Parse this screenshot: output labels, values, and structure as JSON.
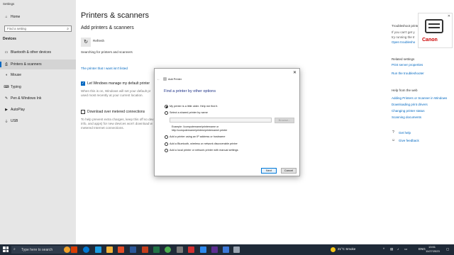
{
  "window": {
    "title": "Settings"
  },
  "sidebar": {
    "home": "Home",
    "search_placeholder": "Find a setting",
    "section": "Devices",
    "items": [
      {
        "label": "Bluetooth & other devices"
      },
      {
        "label": "Printers & scanners"
      },
      {
        "label": "Mouse"
      },
      {
        "label": "Typing"
      },
      {
        "label": "Pen & Windows Ink"
      },
      {
        "label": "AutoPlay"
      },
      {
        "label": "USB"
      }
    ]
  },
  "main": {
    "title": "Printers & scanners",
    "add_heading": "Add printers & scanners",
    "refresh": "Refresh",
    "searching": "Searching for printers and scanners",
    "not_listed": "The printer that I want isn't listed",
    "manage_default": "Let Windows manage my default printer",
    "manage_desc_1": "When this is on, Windows will set your default pr",
    "manage_desc_2": "used most recently at your current location.",
    "metered_label": "Download over metered connections",
    "metered_desc_1": "To help prevent extra charges, keep this off so dev",
    "metered_desc_2": "info, and apps) for new devices won't download w",
    "metered_desc_3": "metered Internet connections."
  },
  "dialog": {
    "title": "Add Printer",
    "heading": "Find a printer by other options",
    "options": [
      {
        "label": "My printer is a little older. Help me find it.",
        "selected": true
      },
      {
        "label": "Select a shared printer by name",
        "selected": false
      },
      {
        "label": "Add a printer using an IP address or hostname",
        "selected": false
      },
      {
        "label": "Add a Bluetooth, wireless or network discoverable printer",
        "selected": false
      },
      {
        "label": "Add a local printer or network printer with manual settings",
        "selected": false
      }
    ],
    "browse": "Browse...",
    "example_1": "Example: \\\\computername\\printername or",
    "example_2": "http://computername/printers/printername/.printer",
    "next": "Next",
    "cancel": "Cancel"
  },
  "right_panel": {
    "troubleshoot_title": "Troubleshoot printers",
    "troubleshoot_desc_1": "If you can't get y",
    "troubleshoot_desc_2": "try running the tr",
    "open_troubleshooter": "Open troublesho",
    "related_title": "Related settings",
    "related_links": [
      "Print server properties",
      "Run the troubleshooter"
    ],
    "help_title": "Help from the web",
    "help_links": [
      "Adding Printers or Scanner in Windows",
      "Downloading print drivers",
      "Changing printer status",
      "Scanning documents"
    ],
    "get_help": "Get help",
    "give_feedback": "Give feedback",
    "brand": "Canon"
  },
  "taskbar": {
    "search_placeholder": "Type here to search",
    "weather": "21°C  Smoke",
    "lang": "ENG",
    "time": "13:51",
    "date": "11/27/2023"
  }
}
